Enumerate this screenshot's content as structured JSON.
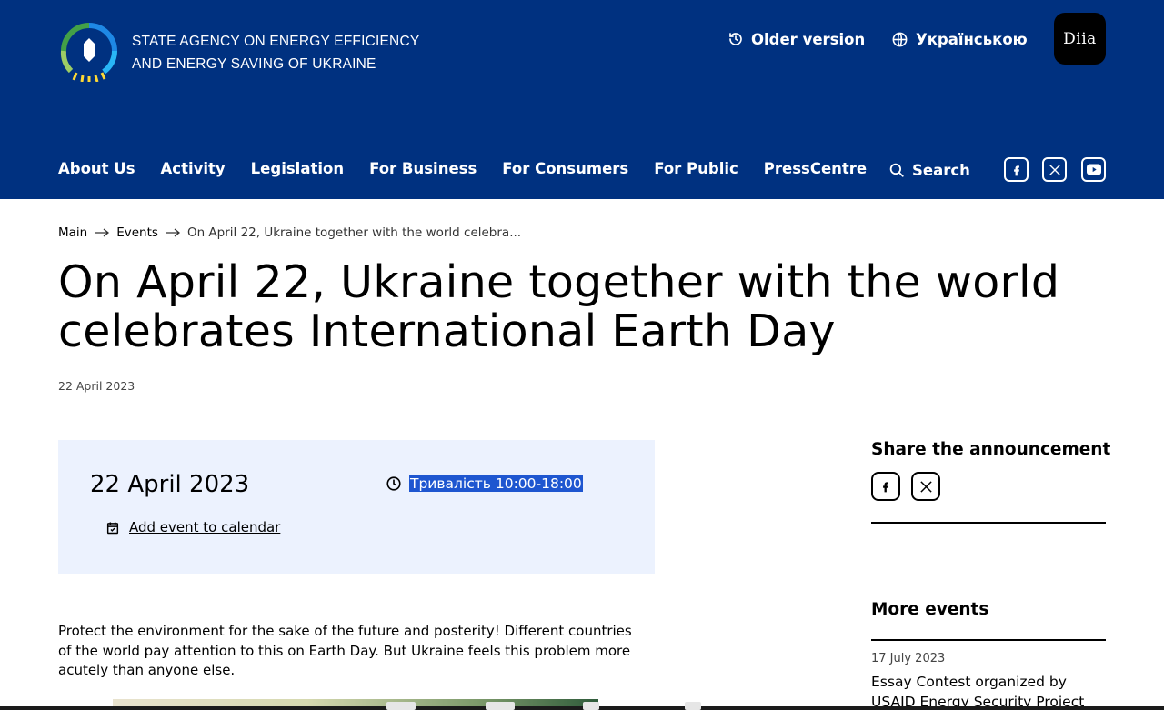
{
  "header": {
    "agency_line1": "STATE AGENCY ON ENERGY EFFICIENCY",
    "agency_line2": "AND ENERGY SAVING OF UKRAINE",
    "older_version": "Older version",
    "language": "Українською",
    "diia": "Diia",
    "nav": [
      "About Us",
      "Activity",
      "Legislation",
      "For Business",
      "For Consumers",
      "For Public",
      "PressCentre"
    ],
    "search": "Search",
    "colors": {
      "background": "#003180",
      "text": "#ffffff"
    }
  },
  "breadcrumb": {
    "main": "Main",
    "events": "Events",
    "current": "On April 22, Ukraine together with the world celebra..."
  },
  "article": {
    "title": "On April 22, Ukraine together with the world celebrates International Earth Day",
    "date": "22 April 2023",
    "paragraph": "Protect the environment for the sake of the future and posterity! Different countries of the world pay attention to this on Earth Day. But Ukraine feels this problem more acutely than anyone else."
  },
  "event": {
    "date": "22 April 2023",
    "duration": "Тривалість 10:00-18:00",
    "add_to_calendar": "Add event to calendar",
    "box_color": "#ecf2fe",
    "highlight_color": "#1e56d0"
  },
  "sidebar": {
    "share_heading": "Share the announcement",
    "more_heading": "More events",
    "more_events": [
      {
        "date": "17 July 2023",
        "title": "Essay Contest organized by USAID Energy Security Project"
      }
    ]
  },
  "icons": {
    "header": [
      "history-icon",
      "globe-icon",
      "search-icon",
      "facebook-icon",
      "x-icon",
      "youtube-icon"
    ],
    "event": [
      "clock-icon",
      "calendar-icon"
    ],
    "share": [
      "facebook-icon",
      "x-icon"
    ]
  }
}
